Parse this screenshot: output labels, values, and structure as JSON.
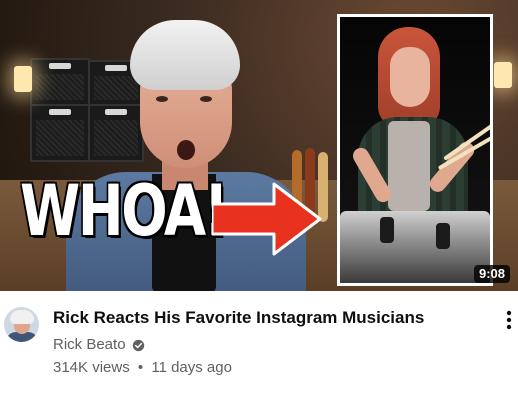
{
  "thumbnail": {
    "overlay_text": "WHOA!",
    "duration": "9:08",
    "arrow_color": "#e8321f"
  },
  "video": {
    "title": "Rick Reacts His Favorite Instagram Musicians",
    "channel": "Rick Beato",
    "views": "314K views",
    "separator": "•",
    "age": "11 days ago"
  },
  "icons": {
    "verified": "verified-check-icon",
    "menu": "more-vertical-icon"
  },
  "colors": {
    "title": "#0f0f0f",
    "secondary_text": "#606060",
    "duration_bg": "#000000cc"
  }
}
